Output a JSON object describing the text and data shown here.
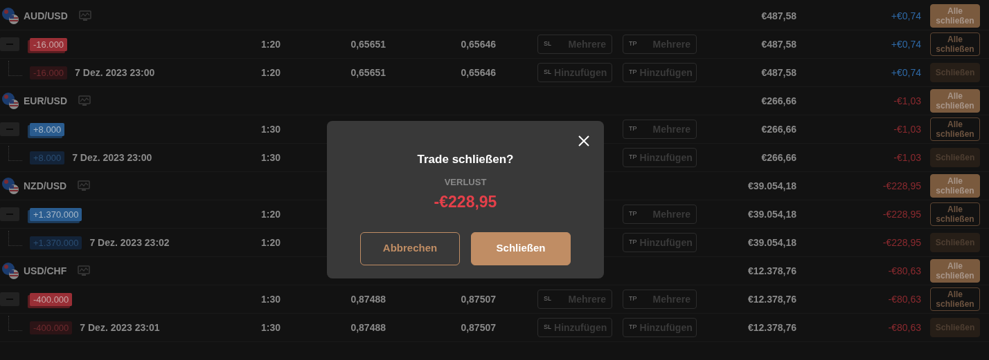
{
  "groups": [
    {
      "pair": "AUD/USD",
      "value": "€487,58",
      "pnl": "+€0,74",
      "gain": true,
      "button": {
        "label": "Alle schließen",
        "kind": "filled"
      },
      "position": {
        "amount": "-16.000",
        "buy": false,
        "leverage": "1:20",
        "open_price": "0,65651",
        "current_price": "0,65646",
        "sl": {
          "tag": "SL",
          "text": "Mehrere"
        },
        "tp": {
          "tag": "TP",
          "text": "Mehrere"
        },
        "value": "€487,58",
        "pnl": "+€0,74",
        "button": {
          "label": "Alle schließen",
          "kind": "outline"
        }
      },
      "trade": {
        "amount": "-16.000",
        "buy": false,
        "date": "7 Dez. 2023 23:00",
        "leverage": "1:20",
        "open_price": "0,65651",
        "current_price": "0,65646",
        "sl": {
          "tag": "SL",
          "text": "Hinzufügen"
        },
        "tp": {
          "tag": "TP",
          "text": "Hinzufügen"
        },
        "value": "€487,58",
        "pnl": "+€0,74",
        "button": {
          "label": "Schließen",
          "kind": "subtle"
        }
      }
    },
    {
      "pair": "EUR/USD",
      "value": "€266,66",
      "pnl": "-€1,03",
      "gain": false,
      "button": {
        "label": "Alle schließen",
        "kind": "filled"
      },
      "position": {
        "amount": "+8.000",
        "buy": true,
        "leverage": "1:30",
        "tp": {
          "tag": "TP",
          "text": "Mehrere"
        },
        "value": "€266,66",
        "pnl": "-€1,03",
        "button": {
          "label": "Alle schließen",
          "kind": "outline"
        }
      },
      "trade": {
        "amount": "+8.000",
        "buy": true,
        "date": "7 Dez. 2023 23:00",
        "leverage": "1:30",
        "tp": {
          "tag": "TP",
          "text": "Hinzufügen"
        },
        "value": "€266,66",
        "pnl": "-€1,03",
        "button": {
          "label": "Schließen",
          "kind": "subtle"
        }
      }
    },
    {
      "pair": "NZD/USD",
      "value": "€39.054,18",
      "pnl": "-€228,95",
      "gain": false,
      "button": {
        "label": "Alle schließen",
        "kind": "filled"
      },
      "position": {
        "amount": "+1.370.000",
        "buy": true,
        "leverage": "1:20",
        "tp": {
          "tag": "TP",
          "text": "Mehrere"
        },
        "value": "€39.054,18",
        "pnl": "-€228,95",
        "button": {
          "label": "Alle schließen",
          "kind": "outline"
        }
      },
      "trade": {
        "amount": "+1.370.000",
        "buy": true,
        "date": "7 Dez. 2023 23:02",
        "leverage": "1:20",
        "tp": {
          "tag": "TP",
          "text": "Hinzufügen"
        },
        "value": "€39.054,18",
        "pnl": "-€228,95",
        "button": {
          "label": "Schließen",
          "kind": "subtle"
        }
      }
    },
    {
      "pair": "USD/CHF",
      "value": "€12.378,76",
      "pnl": "-€80,63",
      "gain": false,
      "button": {
        "label": "Alle schließen",
        "kind": "filled"
      },
      "position": {
        "amount": "-400.000",
        "buy": false,
        "leverage": "1:30",
        "open_price": "0,87488",
        "current_price": "0,87507",
        "sl": {
          "tag": "SL",
          "text": "Mehrere"
        },
        "tp": {
          "tag": "TP",
          "text": "Mehrere"
        },
        "value": "€12.378,76",
        "pnl": "-€80,63",
        "button": {
          "label": "Alle schließen",
          "kind": "outline"
        }
      },
      "trade": {
        "amount": "-400.000",
        "buy": false,
        "date": "7 Dez. 2023 23:01",
        "leverage": "1:30",
        "open_price": "0,87488",
        "current_price": "0,87507",
        "sl": {
          "tag": "SL",
          "text": "Hinzufügen"
        },
        "tp": {
          "tag": "TP",
          "text": "Hinzufügen"
        },
        "value": "€12.378,76",
        "pnl": "-€80,63",
        "button": {
          "label": "Schließen",
          "kind": "subtle"
        }
      }
    }
  ],
  "dialog": {
    "title": "Trade schließen?",
    "label": "VERLUST",
    "amount": "-€228,95",
    "buttons": [
      {
        "label": "Abbrechen",
        "kind": "secondary"
      },
      {
        "label": "Schließen",
        "kind": "primary"
      }
    ]
  }
}
